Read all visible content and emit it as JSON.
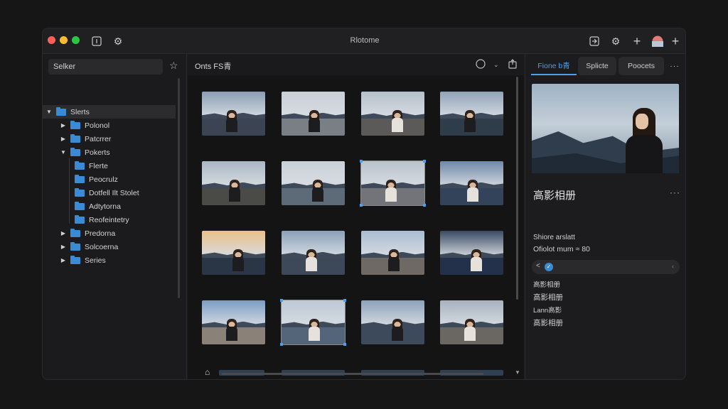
{
  "window": {
    "title": "Rlotome"
  },
  "titlebar": {
    "traffic_colors": [
      "#ff5f57",
      "#febc2e",
      "#28c840"
    ],
    "left_icons": [
      "info-icon",
      "gear-icon"
    ],
    "right_icons": [
      "export-icon",
      "gear-icon",
      "plus-icon",
      "avatar",
      "add-icon"
    ]
  },
  "sidebar": {
    "search_placeholder": "Selker",
    "items": [
      {
        "label": "Slerts",
        "level": 0,
        "expanded": true,
        "selected": true
      },
      {
        "label": "Polonol",
        "level": 1,
        "expanded": false
      },
      {
        "label": "Patcrrer",
        "level": 1,
        "expanded": false
      },
      {
        "label": "Pokerts",
        "level": 1,
        "expanded": true
      },
      {
        "label": "Flerte",
        "level": 2
      },
      {
        "label": "Peocrulz",
        "level": 2
      },
      {
        "label": "Dotfell Ilt Stolet",
        "level": 2
      },
      {
        "label": "Adtytorna",
        "level": 2
      },
      {
        "label": "Reofeintetry",
        "level": 2
      },
      {
        "label": "Predorna",
        "level": 1,
        "expanded": false
      },
      {
        "label": "Solcoerna",
        "level": 1,
        "expanded": false
      },
      {
        "label": "Series",
        "level": 1,
        "expanded": false
      }
    ]
  },
  "center": {
    "title": "Onts FS青",
    "icons": [
      "circle-icon",
      "chevron-down-icon",
      "share-icon"
    ],
    "thumbnails": [
      {
        "name": "photo-1",
        "sky": "#8a9db3",
        "ground": "#3b4452",
        "light": false,
        "selected": false
      },
      {
        "name": "photo-2",
        "sky": "#c9cfd6",
        "ground": "#7a7f86",
        "light": false,
        "selected": false
      },
      {
        "name": "photo-3",
        "sky": "#b6c0ca",
        "ground": "#5c5a58",
        "light": true,
        "selected": false
      },
      {
        "name": "photo-4",
        "sky": "#8fa3b8",
        "ground": "#2f3c4a",
        "light": false,
        "selected": false
      },
      {
        "name": "photo-5",
        "sky": "#a9b7c4",
        "ground": "#4a4a46",
        "light": false,
        "selected": false
      },
      {
        "name": "photo-6",
        "sky": "#c9d1d8",
        "ground": "#5d6a78",
        "light": false,
        "selected": false
      },
      {
        "name": "photo-7",
        "sky": "#b9c3cc",
        "ground": "#72747a",
        "light": true,
        "selected": true
      },
      {
        "name": "photo-8",
        "sky": "#6f88a8",
        "ground": "#33435a",
        "light": true,
        "selected": false
      },
      {
        "name": "photo-9",
        "sky": "#e9c08a",
        "ground": "#2a3546",
        "light": false,
        "selected": false
      },
      {
        "name": "photo-10",
        "sky": "#8aa1ba",
        "ground": "#3d4858",
        "light": true,
        "selected": false
      },
      {
        "name": "photo-11",
        "sky": "#a9bdd2",
        "ground": "#6e6964",
        "light": false,
        "selected": false
      },
      {
        "name": "photo-12",
        "sky": "#394a63",
        "ground": "#23324a",
        "light": true,
        "selected": false
      },
      {
        "name": "photo-13",
        "sky": "#7c9cc4",
        "ground": "#8a8178",
        "light": false,
        "selected": false
      },
      {
        "name": "photo-14",
        "sky": "#bcc8d4",
        "ground": "#556579",
        "light": true,
        "selected": true
      },
      {
        "name": "photo-15",
        "sky": "#8ca1ba",
        "ground": "#3d4a5c",
        "light": false,
        "selected": false
      },
      {
        "name": "photo-16",
        "sky": "#a6b2be",
        "ground": "#6a6763",
        "light": true,
        "selected": false
      }
    ]
  },
  "right": {
    "tabs": [
      {
        "label": "Fione b青",
        "active": true
      },
      {
        "label": "Splicte",
        "active": false
      },
      {
        "label": "Poocets",
        "active": false
      }
    ],
    "title": "高影相册",
    "line1": "Shiore arslatt",
    "line2": "Ofiolot mum ≈ 80",
    "field_lt": "<",
    "field_gt": "‹",
    "meta": [
      "高影相册",
      "高影相册",
      "Lann高影",
      "高影相册"
    ],
    "accent": "#4a9ff0"
  }
}
